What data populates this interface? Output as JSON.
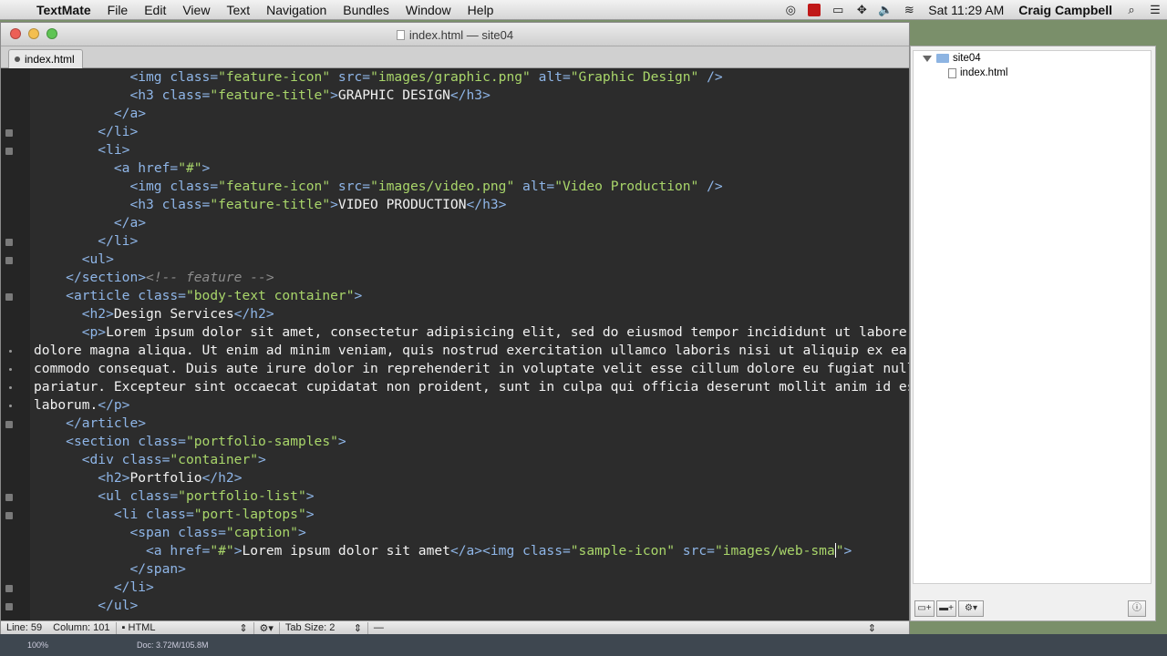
{
  "menubar": {
    "app_name": "TextMate",
    "items": [
      "File",
      "Edit",
      "View",
      "Text",
      "Navigation",
      "Bundles",
      "Window",
      "Help"
    ],
    "clock": "Sat 11:29 AM",
    "user": "Craig Campbell"
  },
  "window": {
    "title": "index.html — site04",
    "tab_label": "index.html"
  },
  "editor": {
    "lines": [
      "<img class=\"feature-icon\" src=\"images/graphic.png\" alt=\"Graphic Design\" />",
      "<h3 class=\"feature-title\">GRAPHIC DESIGN</h3>",
      "</a>",
      "</li>",
      "<li>",
      "<a href=\"#\">",
      "<img class=\"feature-icon\" src=\"images/video.png\" alt=\"Video Production\" />",
      "<h3 class=\"feature-title\">VIDEO PRODUCTION</h3>",
      "</a>",
      "</li>",
      "<ul>",
      "</section><!-- feature -->",
      "<article class=\"body-text container\">",
      "<h2>Design Services</h2>",
      "<p>Lorem ipsum dolor sit amet, consectetur adipisicing elit, sed do eiusmod tempor incididunt ut labore et",
      "dolore magna aliqua. Ut enim ad minim veniam, quis nostrud exercitation ullamco laboris nisi ut aliquip ex ea",
      "commodo consequat. Duis aute irure dolor in reprehenderit in voluptate velit esse cillum dolore eu fugiat nulla",
      "pariatur. Excepteur sint occaecat cupidatat non proident, sunt in culpa qui officia deserunt mollit anim id est",
      "laborum.</p>",
      "</article>",
      "<section class=\"portfolio-samples\">",
      "<div class=\"container\">",
      "<h2>Portfolio</h2>",
      "<ul class=\"portfolio-list\">",
      "<li class=\"port-laptops\">",
      "<span class=\"caption\">",
      "<a href=\"#\">Lorem ipsum dolor sit amet</a><img class=\"sample-icon\" src=\"images/web-sma\">",
      "</span>",
      "</li>",
      "</ul>"
    ]
  },
  "statusbar": {
    "line": "Line: 59",
    "column": "Column: 101",
    "language": "HTML",
    "tab_size": "Tab Size:  2",
    "symbol": "—"
  },
  "drawer": {
    "folder": "site04",
    "file": "index.html"
  },
  "underlay": {
    "zoom": "100%",
    "doc": "Doc: 3.72M/105.8M"
  },
  "colors": {
    "tag": "#8fb6e8",
    "string": "#a9d66a",
    "comment": "#8d8d8d",
    "background": "#2c2c2c"
  }
}
